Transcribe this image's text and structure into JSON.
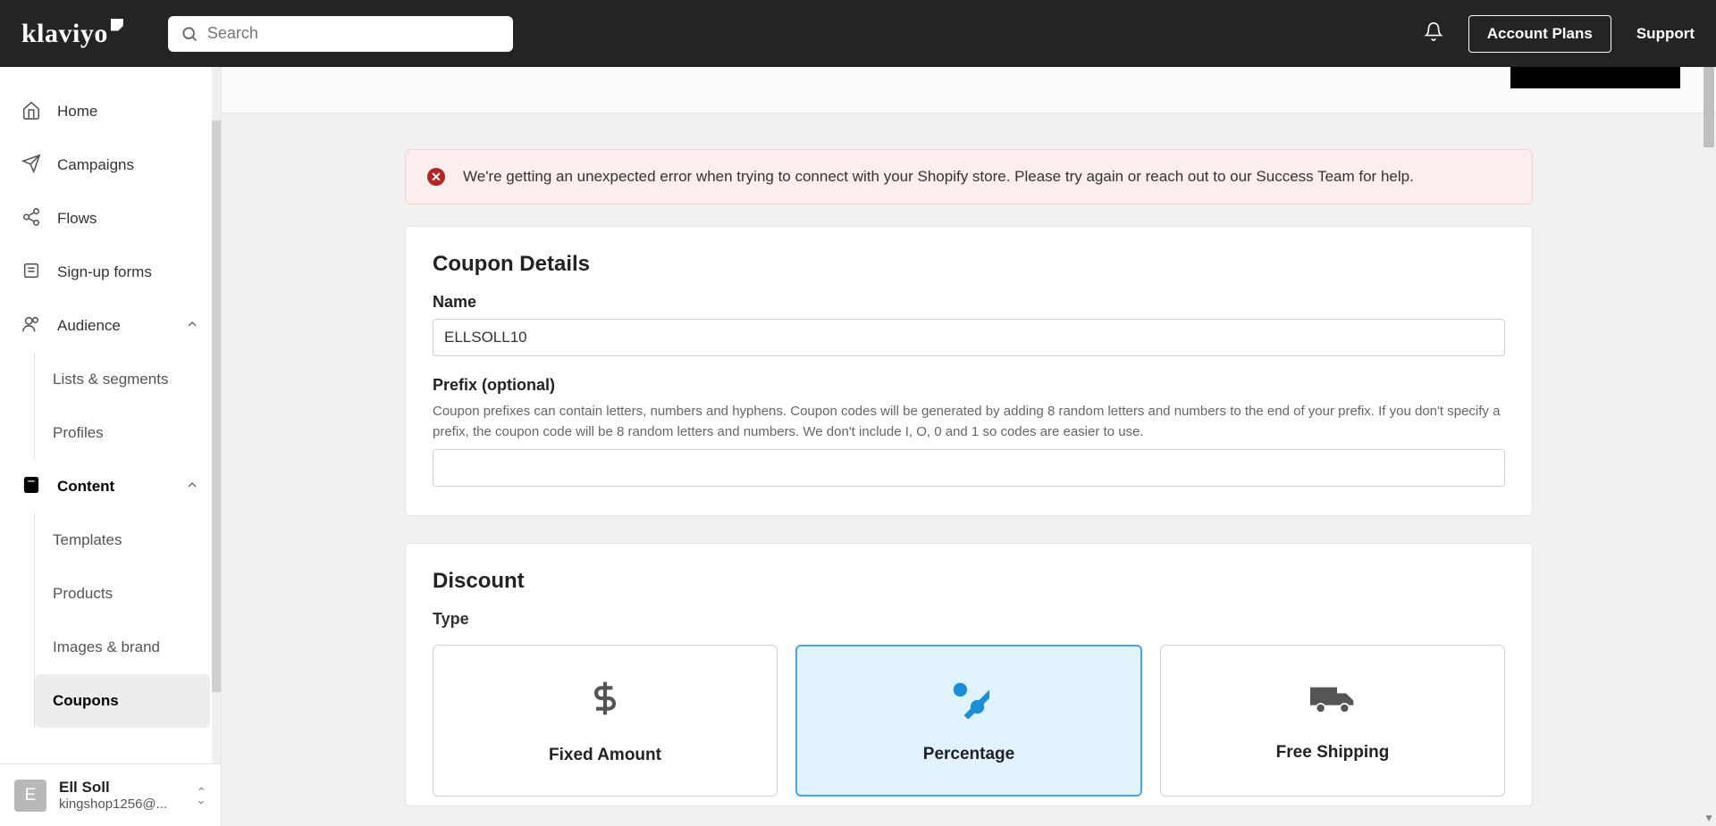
{
  "header": {
    "brand": "klaviyo",
    "search_placeholder": "Search",
    "account_plans": "Account Plans",
    "support": "Support"
  },
  "sidebar": {
    "home": "Home",
    "campaigns": "Campaigns",
    "flows": "Flows",
    "signup_forms": "Sign-up forms",
    "audience": "Audience",
    "audience_items": {
      "lists_segments": "Lists & segments",
      "profiles": "Profiles"
    },
    "content": "Content",
    "content_items": {
      "templates": "Templates",
      "products": "Products",
      "images_brand": "Images & brand",
      "coupons": "Coupons"
    }
  },
  "user": {
    "initial": "E",
    "name": "Ell Soll",
    "email": "kingshop1256@..."
  },
  "alert": {
    "message": "We're getting an unexpected error when trying to connect with your Shopify store. Please try again or reach out to our Success Team for help."
  },
  "coupon_details": {
    "heading": "Coupon Details",
    "name_label": "Name",
    "name_value": "ELLSOLL10",
    "prefix_label": "Prefix (optional)",
    "prefix_help": "Coupon prefixes can contain letters, numbers and hyphens. Coupon codes will be generated by adding 8 random letters and numbers to the end of your prefix. If you don't specify a prefix, the coupon code will be 8 random letters and numbers. We don't include I, O, 0 and 1 so codes are easier to use.",
    "prefix_value": ""
  },
  "discount": {
    "heading": "Discount",
    "type_label": "Type",
    "types": {
      "fixed": "Fixed Amount",
      "percentage": "Percentage",
      "free_shipping": "Free Shipping"
    }
  }
}
